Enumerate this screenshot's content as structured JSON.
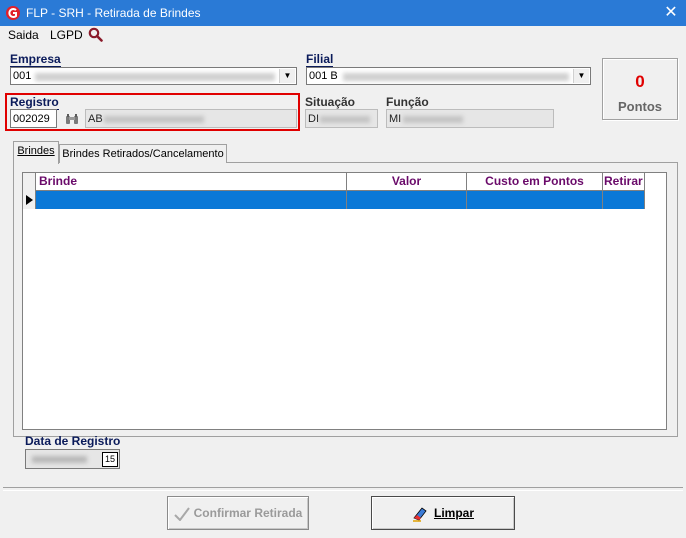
{
  "window": {
    "title": "FLP - SRH - Retirada de Brindes",
    "close_glyph": "✕"
  },
  "menu": {
    "items": [
      "Saida",
      "LGPD"
    ]
  },
  "empresa": {
    "label": "Empresa",
    "code": "001"
  },
  "filial": {
    "label": "Filial",
    "code": "001 B"
  },
  "registro": {
    "label": "Registro",
    "value": "002029",
    "name_prefix": "AB"
  },
  "situacao": {
    "label": "Situação",
    "value_prefix": "DI"
  },
  "funcao": {
    "label": "Função",
    "value_prefix": "MI"
  },
  "pontos": {
    "value": "0",
    "label": "Pontos"
  },
  "tabs": [
    {
      "label": "Brindes",
      "active": true
    },
    {
      "label": "Brindes Retirados/Cancelamento",
      "active": false
    }
  ],
  "grid": {
    "columns": [
      "Brinde",
      "Valor",
      "Custo em Pontos",
      "Retirar"
    ]
  },
  "data_registro": {
    "label": "Data de Registro",
    "calendar_glyph": "15"
  },
  "buttons": {
    "confirmar": "Confirmar Retirada",
    "limpar": "Limpar"
  },
  "colors": {
    "titlebar": "#2a7ad6",
    "selected_row": "#0a78d7",
    "highlight_box": "#e00000",
    "points": "#e00000",
    "column_header": "#6a0a6a"
  },
  "icons": [
    "app-logo-icon",
    "close-icon",
    "search-icon",
    "binoculars-icon",
    "dropdown-arrow-icon",
    "checkmark-icon",
    "eraser-icon",
    "calendar-icon",
    "row-indicator-icon"
  ]
}
